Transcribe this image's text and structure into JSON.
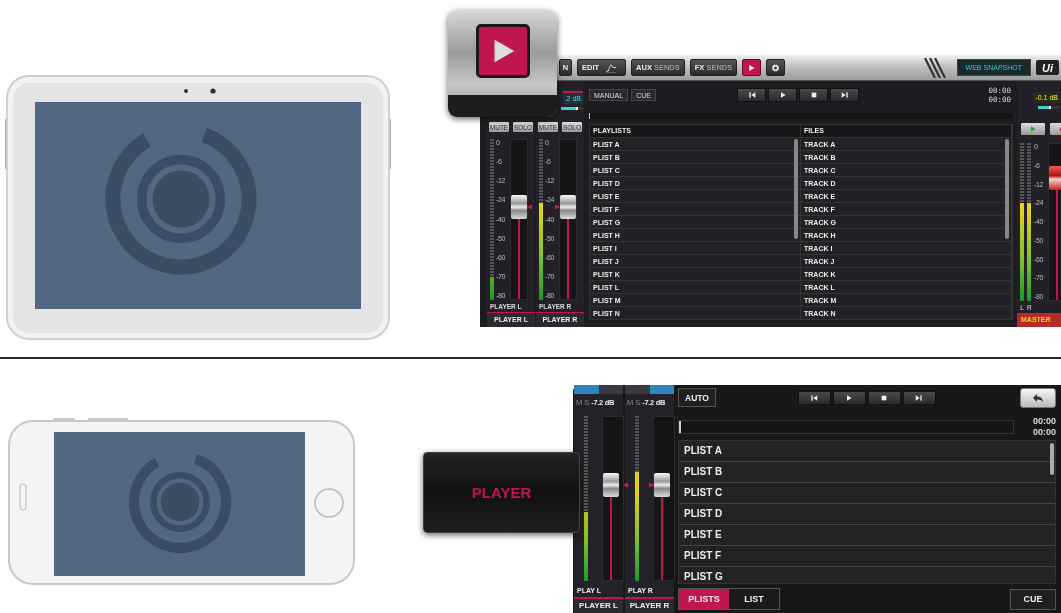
{
  "tablet_app": {
    "toolbar": {
      "buttons": [
        {
          "kind": "text",
          "label": "N",
          "selected": false
        },
        {
          "kind": "edit",
          "label": "EDIT",
          "selected": false
        },
        {
          "kind": "split",
          "label": "AUX",
          "sublabel": "SENDS",
          "selected": false
        },
        {
          "kind": "split",
          "label": "FX",
          "sublabel": "SENDS",
          "selected": false
        },
        {
          "kind": "play",
          "selected": true
        },
        {
          "kind": "gear",
          "selected": false
        }
      ],
      "snapshot": "WEB SNAPSHOT",
      "logo": "Ui"
    },
    "channels": [
      {
        "kind": "left",
        "mute": "MUTE",
        "solo": "SOLO",
        "scale": [
          "0",
          "-6",
          "-12",
          "-24",
          "-40",
          "-50",
          "-60",
          "-70",
          "-80"
        ],
        "meter": {
          "level": 0.14
        },
        "fader": {
          "level": 0.58
        },
        "short_name": "PLAYER L",
        "name": "PLAYER L"
      },
      {
        "kind": "right",
        "gain": {
          "text": ".2 dB",
          "level": 0.7
        },
        "mute": "MUTE",
        "solo": "SOLO",
        "scale": [
          "0",
          "-6",
          "-12",
          "-24",
          "-40",
          "-50",
          "-60",
          "-70",
          "-80"
        ],
        "meter": {
          "level": 0.6
        },
        "fader": {
          "level": 0.58
        },
        "short_name": "PLAYER R",
        "name": "PLAYER R"
      }
    ],
    "player": {
      "modes": [
        "MANUAL",
        "CUE"
      ],
      "times": [
        "00:00",
        "00:00"
      ],
      "progress": {
        "level": 0
      },
      "columns": [
        {
          "header": "PLAYLISTS",
          "items": [
            "PLIST A",
            "PLIST B",
            "PLIST C",
            "PLIST D",
            "PLIST E",
            "PLIST F",
            "PLIST G",
            "PLIST H",
            "PLIST I",
            "PLIST J",
            "PLIST K",
            "PLIST L",
            "PLIST M",
            "PLIST N"
          ]
        },
        {
          "header": "FILES",
          "items": [
            "TRACK A",
            "TRACK B",
            "TRACK C",
            "TRACK D",
            "TRACK E",
            "TRACK F",
            "TRACK G",
            "TRACK H",
            "TRACK I",
            "TRACK J",
            "TRACK K",
            "TRACK L",
            "TRACK M",
            "TRACK N"
          ]
        }
      ]
    },
    "master": {
      "gain": {
        "text": "-0.1 dB",
        "level": 0.5
      },
      "meters": [
        {
          "label": "L",
          "level": 0.62
        },
        {
          "label": "R",
          "level": 0.62
        }
      ],
      "scale": [
        "0",
        "-6",
        "-12",
        "-24",
        "-40",
        "-50",
        "-60",
        "-70",
        "-80"
      ],
      "fader": {
        "level": 0.78
      },
      "name": "MASTER"
    }
  },
  "phone_app": {
    "channels": [
      {
        "kind": "left",
        "mute": "M",
        "solo": "S",
        "gain": "-7.2 dB",
        "meter": {
          "level": 0.42
        },
        "fader": {
          "level": 0.58
        },
        "short_name": "PLAY L",
        "name": "PLAYER L"
      },
      {
        "kind": "right",
        "mute": "M",
        "solo": "S",
        "gain": "-7.2 dB",
        "meter": {
          "level": 0.66
        },
        "fader": {
          "level": 0.58
        },
        "short_name": "PLAY R",
        "name": "PLAYER R"
      }
    ],
    "mode": "AUTO",
    "times": [
      "00:00",
      "00:00"
    ],
    "progress": {
      "level": 0
    },
    "playlists": [
      "PLIST A",
      "PLIST B",
      "PLIST C",
      "PLIST D",
      "PLIST E",
      "PLIST F",
      "PLIST G"
    ],
    "tabs": [
      {
        "label": "PLISTS",
        "selected": true
      },
      {
        "label": "LIST",
        "selected": false
      }
    ],
    "cue": "CUE"
  },
  "callout": {
    "label": "PLAYER"
  }
}
